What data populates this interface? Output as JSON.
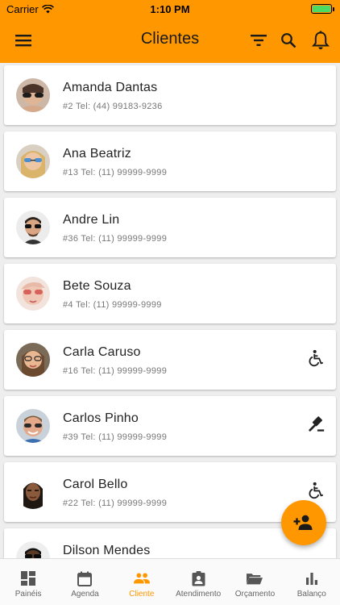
{
  "status_bar": {
    "carrier": "Carrier",
    "time": "1:10 PM"
  },
  "app_bar": {
    "title": "Clientes"
  },
  "clients": [
    {
      "name": "Amanda Dantas",
      "info": "#2 Tel: (44) 99183-9236",
      "tag": ""
    },
    {
      "name": "Ana Beatriz",
      "info": "#13 Tel: (11) 99999-9999",
      "tag": ""
    },
    {
      "name": "Andre Lin",
      "info": "#36 Tel: (11) 99999-9999",
      "tag": ""
    },
    {
      "name": "Bete Souza",
      "info": "#4 Tel: (11) 99999-9999",
      "tag": ""
    },
    {
      "name": "Carla Caruso",
      "info": "#16 Tel: (11) 99999-9999",
      "tag": "accessible-icon"
    },
    {
      "name": "Carlos Pinho",
      "info": "#39 Tel: (11) 99999-9999",
      "tag": "gavel-icon"
    },
    {
      "name": "Carol Bello",
      "info": "#22 Tel: (11) 99999-9999",
      "tag": "accessible-icon"
    },
    {
      "name": "Dilson Mendes",
      "info": "",
      "tag": ""
    }
  ],
  "bottom_nav": [
    {
      "label": "Painéis",
      "icon": "dashboard-icon"
    },
    {
      "label": "Agenda",
      "icon": "calendar-icon"
    },
    {
      "label": "Cliente",
      "icon": "people-icon",
      "active": true
    },
    {
      "label": "Atendimento",
      "icon": "assignment-icon"
    },
    {
      "label": "Orçamento",
      "icon": "folder-open-icon"
    },
    {
      "label": "Balanço",
      "icon": "bar-chart-icon"
    }
  ],
  "colors": {
    "accent": "#ff9800",
    "background": "#eeeeee",
    "card": "#ffffff"
  }
}
